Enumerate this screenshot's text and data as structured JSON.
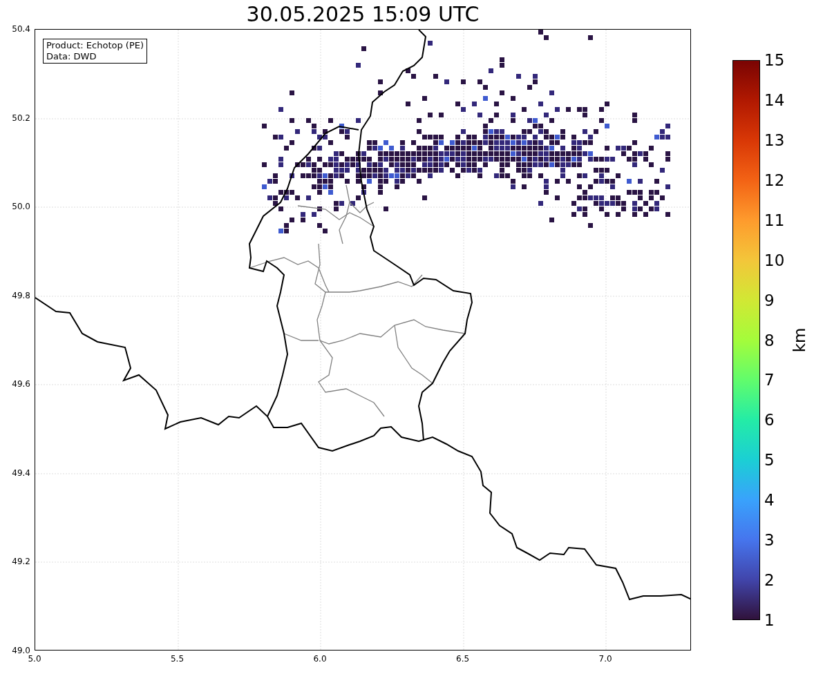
{
  "title": "30.05.2025 15:09 UTC",
  "info_box": {
    "lines": [
      "Product: Echotop (PE)",
      "Data: DWD"
    ]
  },
  "map": {
    "x_ticks": [
      "5.0",
      "5.5",
      "6.0",
      "6.5",
      "7.0"
    ],
    "y_ticks": [
      "50.4",
      "50.2",
      "50.0",
      "49.8",
      "49.6",
      "49.4",
      "49.2",
      "49.0"
    ]
  },
  "colorbar": {
    "label": "km",
    "ticks": [
      "15",
      "14",
      "13",
      "12",
      "11",
      "10",
      "9",
      "8",
      "7",
      "6",
      "5",
      "4",
      "3",
      "2",
      "1"
    ]
  }
}
